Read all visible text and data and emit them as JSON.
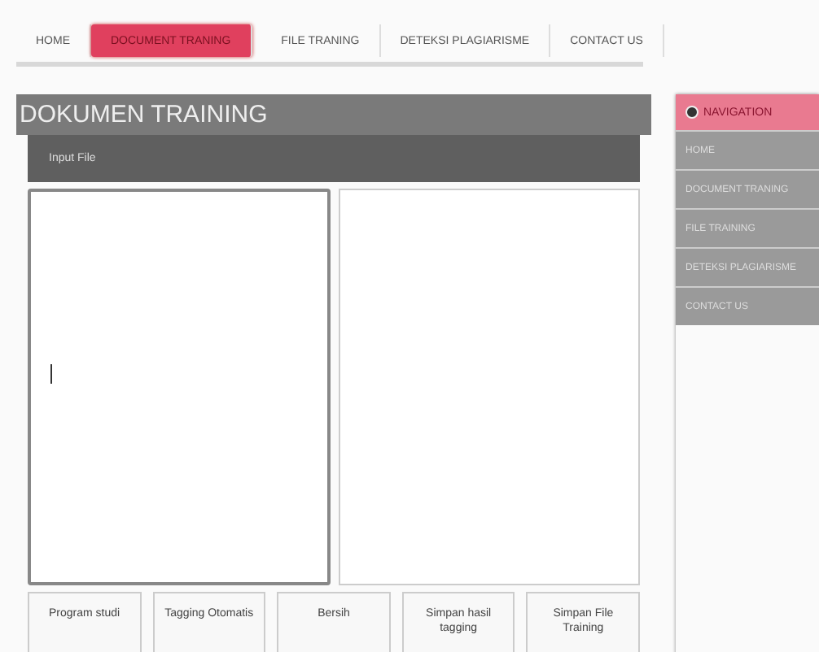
{
  "top_nav": [
    {
      "label": "HOME",
      "selected": false
    },
    {
      "label": "DOCUMENT TRANING",
      "selected": true
    },
    {
      "label": "FILE TRANING",
      "selected": false
    },
    {
      "label": "DETEKSI PLAGIARISME",
      "selected": false
    },
    {
      "label": "CONTACT US",
      "selected": false
    }
  ],
  "panel": {
    "title": "DOKUMEN TRAINING",
    "subtitle": "Input File",
    "text_areas": [
      {
        "focused": true
      },
      {
        "focused": false
      }
    ],
    "buttons": [
      {
        "label": "Program studi"
      },
      {
        "label": "Tagging Otomatis"
      },
      {
        "label": "Bersih"
      },
      {
        "label": "Simpan hasil tagging"
      },
      {
        "label": "Simpan File Training"
      }
    ]
  },
  "sidebar": {
    "title": "NAVIGATION",
    "items": [
      {
        "label": "HOME"
      },
      {
        "label": "DOCUMENT TRANING"
      },
      {
        "label": "FILE TRAINING"
      },
      {
        "label": "DETEKSI PLAGIARISME"
      },
      {
        "label": "CONTACT US"
      }
    ]
  }
}
